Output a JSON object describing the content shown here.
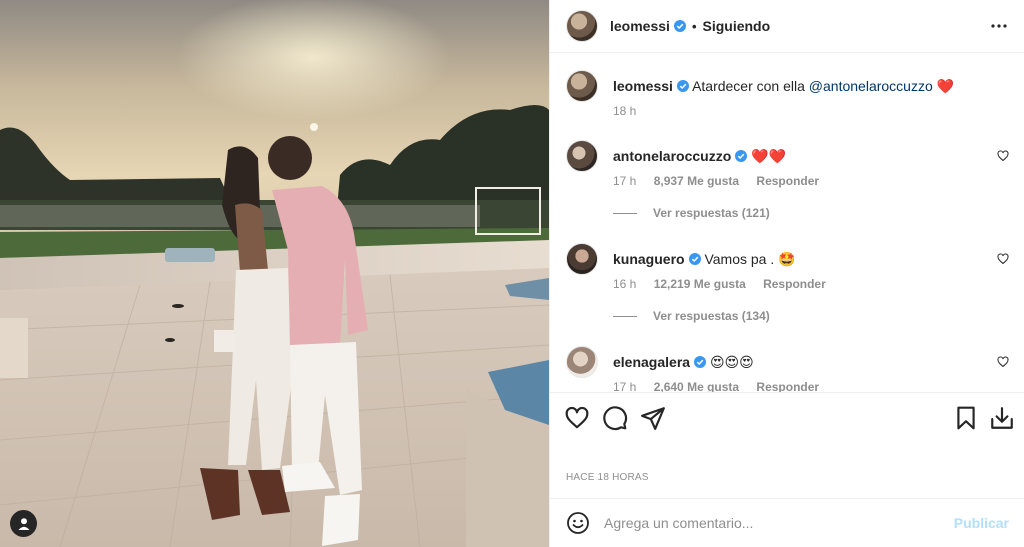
{
  "post": {
    "author": "leomessi",
    "follow_label": "Siguiendo",
    "dot": "•",
    "caption": "Atardecer con ella",
    "caption_mention": "@antonelaroccuzzo",
    "caption_emoji": "❤️",
    "caption_time": "18 h",
    "time_ago": "HACE 18 HORAS"
  },
  "comments": [
    {
      "user": "antonelaroccuzzo",
      "text": "❤️❤️",
      "time": "17 h",
      "likes": "8,937 Me gusta",
      "reply_label": "Responder",
      "replies": "Ver respuestas (121)"
    },
    {
      "user": "kunaguero",
      "text": "Vamos pa . 🤩",
      "time": "16 h",
      "likes": "12,219 Me gusta",
      "reply_label": "Responder",
      "replies": "Ver respuestas (134)"
    },
    {
      "user": "elenagalera",
      "text": "😍😍😍",
      "time": "17 h",
      "likes": "2,640 Me gusta",
      "reply_label": "Responder"
    }
  ],
  "composer": {
    "placeholder": "Agrega un comentario...",
    "publish_label": "Publicar"
  },
  "icons": {
    "more": "more-options-icon",
    "like": "heart-icon",
    "comment": "comment-icon",
    "share": "paper-plane-icon",
    "save": "bookmark-icon",
    "download": "download-icon",
    "emoji": "smiley-icon",
    "verified": "verified-badge-icon",
    "tag": "user-tag-icon"
  },
  "colors": {
    "verified": "#3897f0",
    "link": "#00376b",
    "heart": "#ed4956",
    "muted": "#8e8e8e",
    "publish_disabled": "#b2dffc"
  }
}
